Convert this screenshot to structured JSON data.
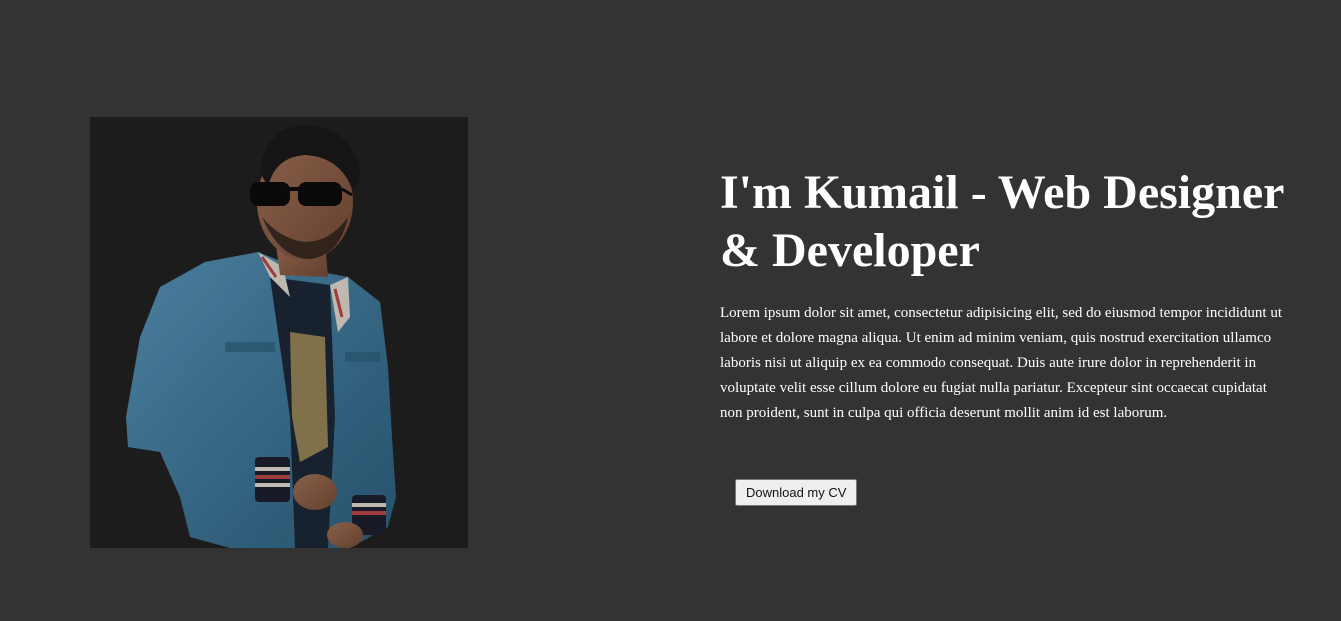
{
  "hero": {
    "headline": "I'm Kumail - Web Designer & Developer",
    "bio": "Lorem ipsum dolor sit amet, consectetur adipisicing elit, sed do eiusmod tempor incididunt ut labore et dolore magna aliqua. Ut enim ad minim veniam, quis nostrud exercitation ullamco laboris nisi ut aliquip ex ea commodo consequat. Duis aute irure dolor in reprehenderit in voluptate velit esse cillum dolore eu fugiat nulla pariatur. Excepteur sint occaecat cupidatat non proident, sunt in culpa qui officia deserunt mollit anim id est laborum.",
    "cv_button_label": "Download my CV"
  },
  "colors": {
    "page_background": "#333333",
    "photo_background": "#232323",
    "text": "#ffffff",
    "jacket": "#4a87ab"
  }
}
